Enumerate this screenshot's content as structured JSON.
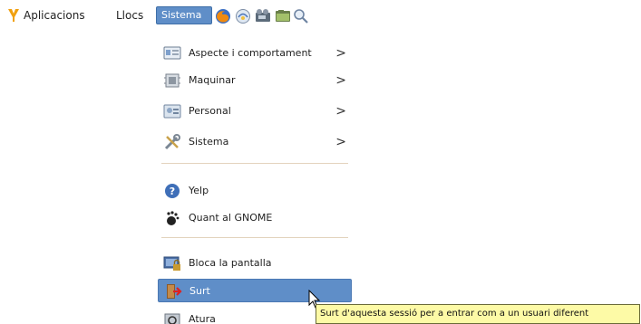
{
  "panel": {
    "apps_label": "Aplicacions",
    "places_label": "Llocs",
    "system_label": "Sistema"
  },
  "menu": {
    "items": [
      {
        "label": "Aspecte i comportament",
        "icon": "appearance-icon",
        "submenu": true
      },
      {
        "label": "Maquinar",
        "icon": "hardware-icon",
        "submenu": true
      },
      {
        "label": "Personal",
        "icon": "personal-icon",
        "submenu": true
      },
      {
        "label": "Sistema",
        "icon": "system-tools-icon",
        "submenu": true
      },
      {
        "label": "Yelp",
        "icon": "help-icon",
        "submenu": false
      },
      {
        "label": "Quant al GNOME",
        "icon": "gnome-foot-icon",
        "submenu": false
      },
      {
        "label": "Bloca la pantalla",
        "icon": "lock-screen-icon",
        "submenu": false
      },
      {
        "label": "Surt",
        "icon": "logout-icon",
        "submenu": false,
        "active": true
      },
      {
        "label": "Atura",
        "icon": "shutdown-icon",
        "submenu": false
      }
    ],
    "arrow_glyph": ">"
  },
  "tooltip": {
    "text": "Surt d'aquesta sessió per a entrar com a un usuari diferent"
  },
  "colors": {
    "selection": "#5f8ec8",
    "tooltip_bg": "#fdfaa6",
    "separator": "#e3d3bd"
  }
}
